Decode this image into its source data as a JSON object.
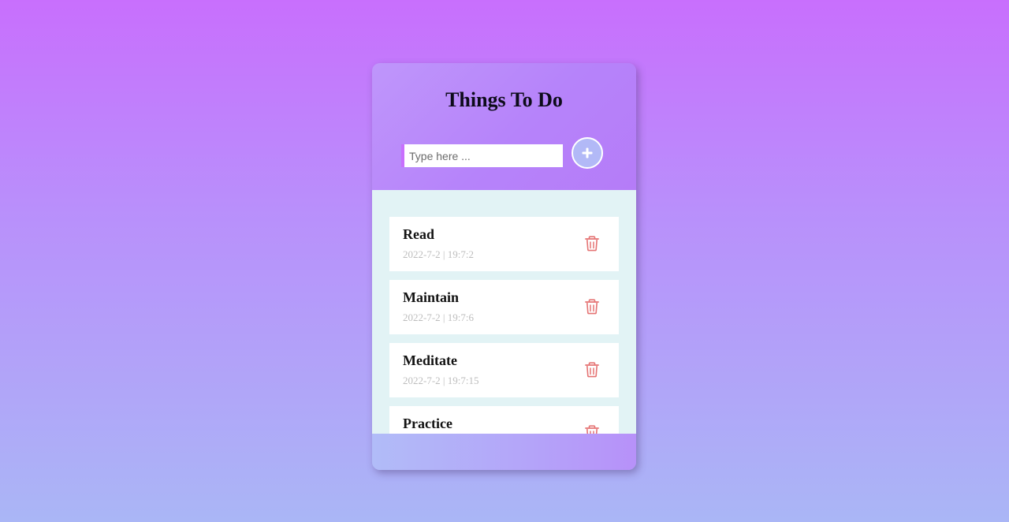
{
  "app": {
    "title": "Things To Do"
  },
  "input": {
    "placeholder": "Type here ...",
    "value": ""
  },
  "add_button": {
    "icon": "plus-icon"
  },
  "todos": [
    {
      "title": "Read",
      "time": "2022-7-2 | 19:7:2",
      "icon": "trash-icon"
    },
    {
      "title": "Maintain",
      "time": "2022-7-2 | 19:7:6",
      "icon": "trash-icon"
    },
    {
      "title": "Meditate",
      "time": "2022-7-2 | 19:7:15",
      "icon": "trash-icon"
    },
    {
      "title": "Practice",
      "time": "",
      "icon": "trash-icon"
    }
  ],
  "colors": {
    "accent": "#c86ffd",
    "add_button": "#b2b9f7",
    "list_background": "#e2f3f5",
    "delete_icon": "#e57373"
  }
}
